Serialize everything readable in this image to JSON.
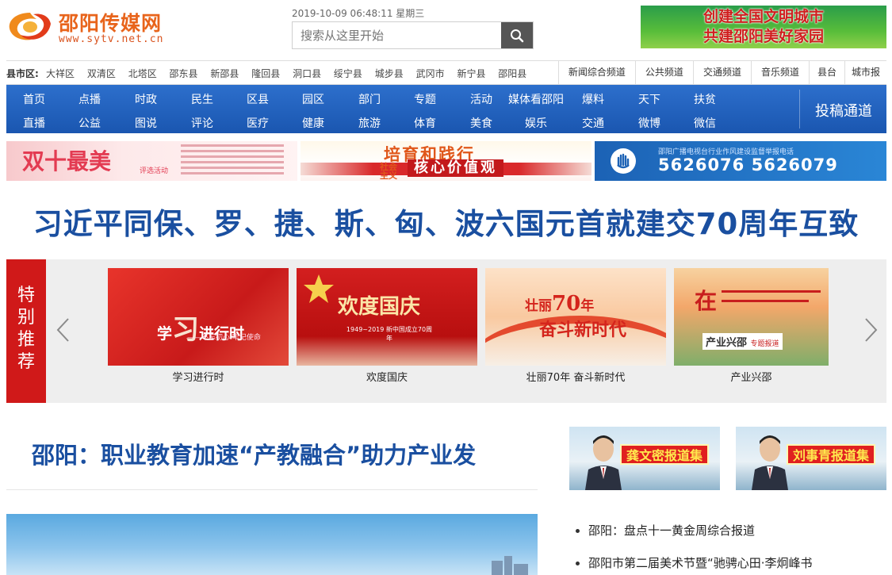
{
  "header": {
    "site_name": "邵阳传媒网",
    "site_url": "www.sytv.net.cn",
    "datetime": "2019-10-09 06:48:11 星期三",
    "search_placeholder": "搜索从这里开始",
    "search_icon": "search-icon",
    "civ_banner_line1": "创建全国文明城市",
    "civ_banner_line2": "共建邵阳美好家园"
  },
  "counties": {
    "label": "县市区:",
    "items": [
      "大祥区",
      "双清区",
      "北塔区",
      "邵东县",
      "新邵县",
      "隆回县",
      "洞口县",
      "绥宁县",
      "城步县",
      "武冈市",
      "新宁县",
      "邵阳县"
    ]
  },
  "channels": [
    "新闻综合频道",
    "公共频道",
    "交通频道",
    "音乐频道",
    "县台",
    "城市报"
  ],
  "nav": {
    "row1": [
      "首页",
      "点播",
      "时政",
      "民生",
      "区县",
      "园区",
      "部门",
      "专题",
      "活动",
      "媒体看邵阳",
      "爆料",
      "天下",
      "扶贫"
    ],
    "row2": [
      "直播",
      "公益",
      "图说",
      "评论",
      "医疗",
      "健康",
      "旅游",
      "体育",
      "美食",
      "娱乐",
      "交通",
      "微博",
      "微信"
    ],
    "tougao": "投稿通道"
  },
  "ads": {
    "ad1_title": "双十最美",
    "ad1_sub": "评选活动",
    "ad2_top": "培育和践行",
    "ad2_left": "社会主义",
    "ad2_bottom": "核心价值观",
    "ad3_small": "邵阳广播电视台行业作风建设监督举报电话",
    "ad3_phone": "5626076  5626079"
  },
  "headline": "习近平同保、罗、捷、斯、匈、波六国元首就建交70周年互致",
  "special": {
    "label": "特别推荐",
    "cards": [
      {
        "caption": "学习进行时",
        "img_text": "学习进行时",
        "img_sub": "——不忘初心 牢记使命"
      },
      {
        "caption": "欢度国庆",
        "img_text": "欢度国庆",
        "img_sub": "1949~2019 新中国成立70周年"
      },
      {
        "caption": "壮丽70年 奋斗新时代",
        "img_text": "壮丽70年 奋斗新时代",
        "img_sub": ""
      },
      {
        "caption": "产业兴邵",
        "img_text": "产业兴邵",
        "img_sub": "专题报道"
      }
    ]
  },
  "sub_headline": "邵阳：职业教育加速“产教融合”助力产业发",
  "leaders": [
    "龚文密报道集",
    "刘事青报道集"
  ],
  "news": [
    "邵阳：盘点十一黄金周综合报道",
    "邵阳市第二届美术节暨“驰骋心田·李炯峰书"
  ],
  "colors": {
    "brand_orange": "#e8641b",
    "nav_blue": "#1a56b0",
    "headline_blue": "#1a4fa0",
    "special_red": "#d01919"
  }
}
